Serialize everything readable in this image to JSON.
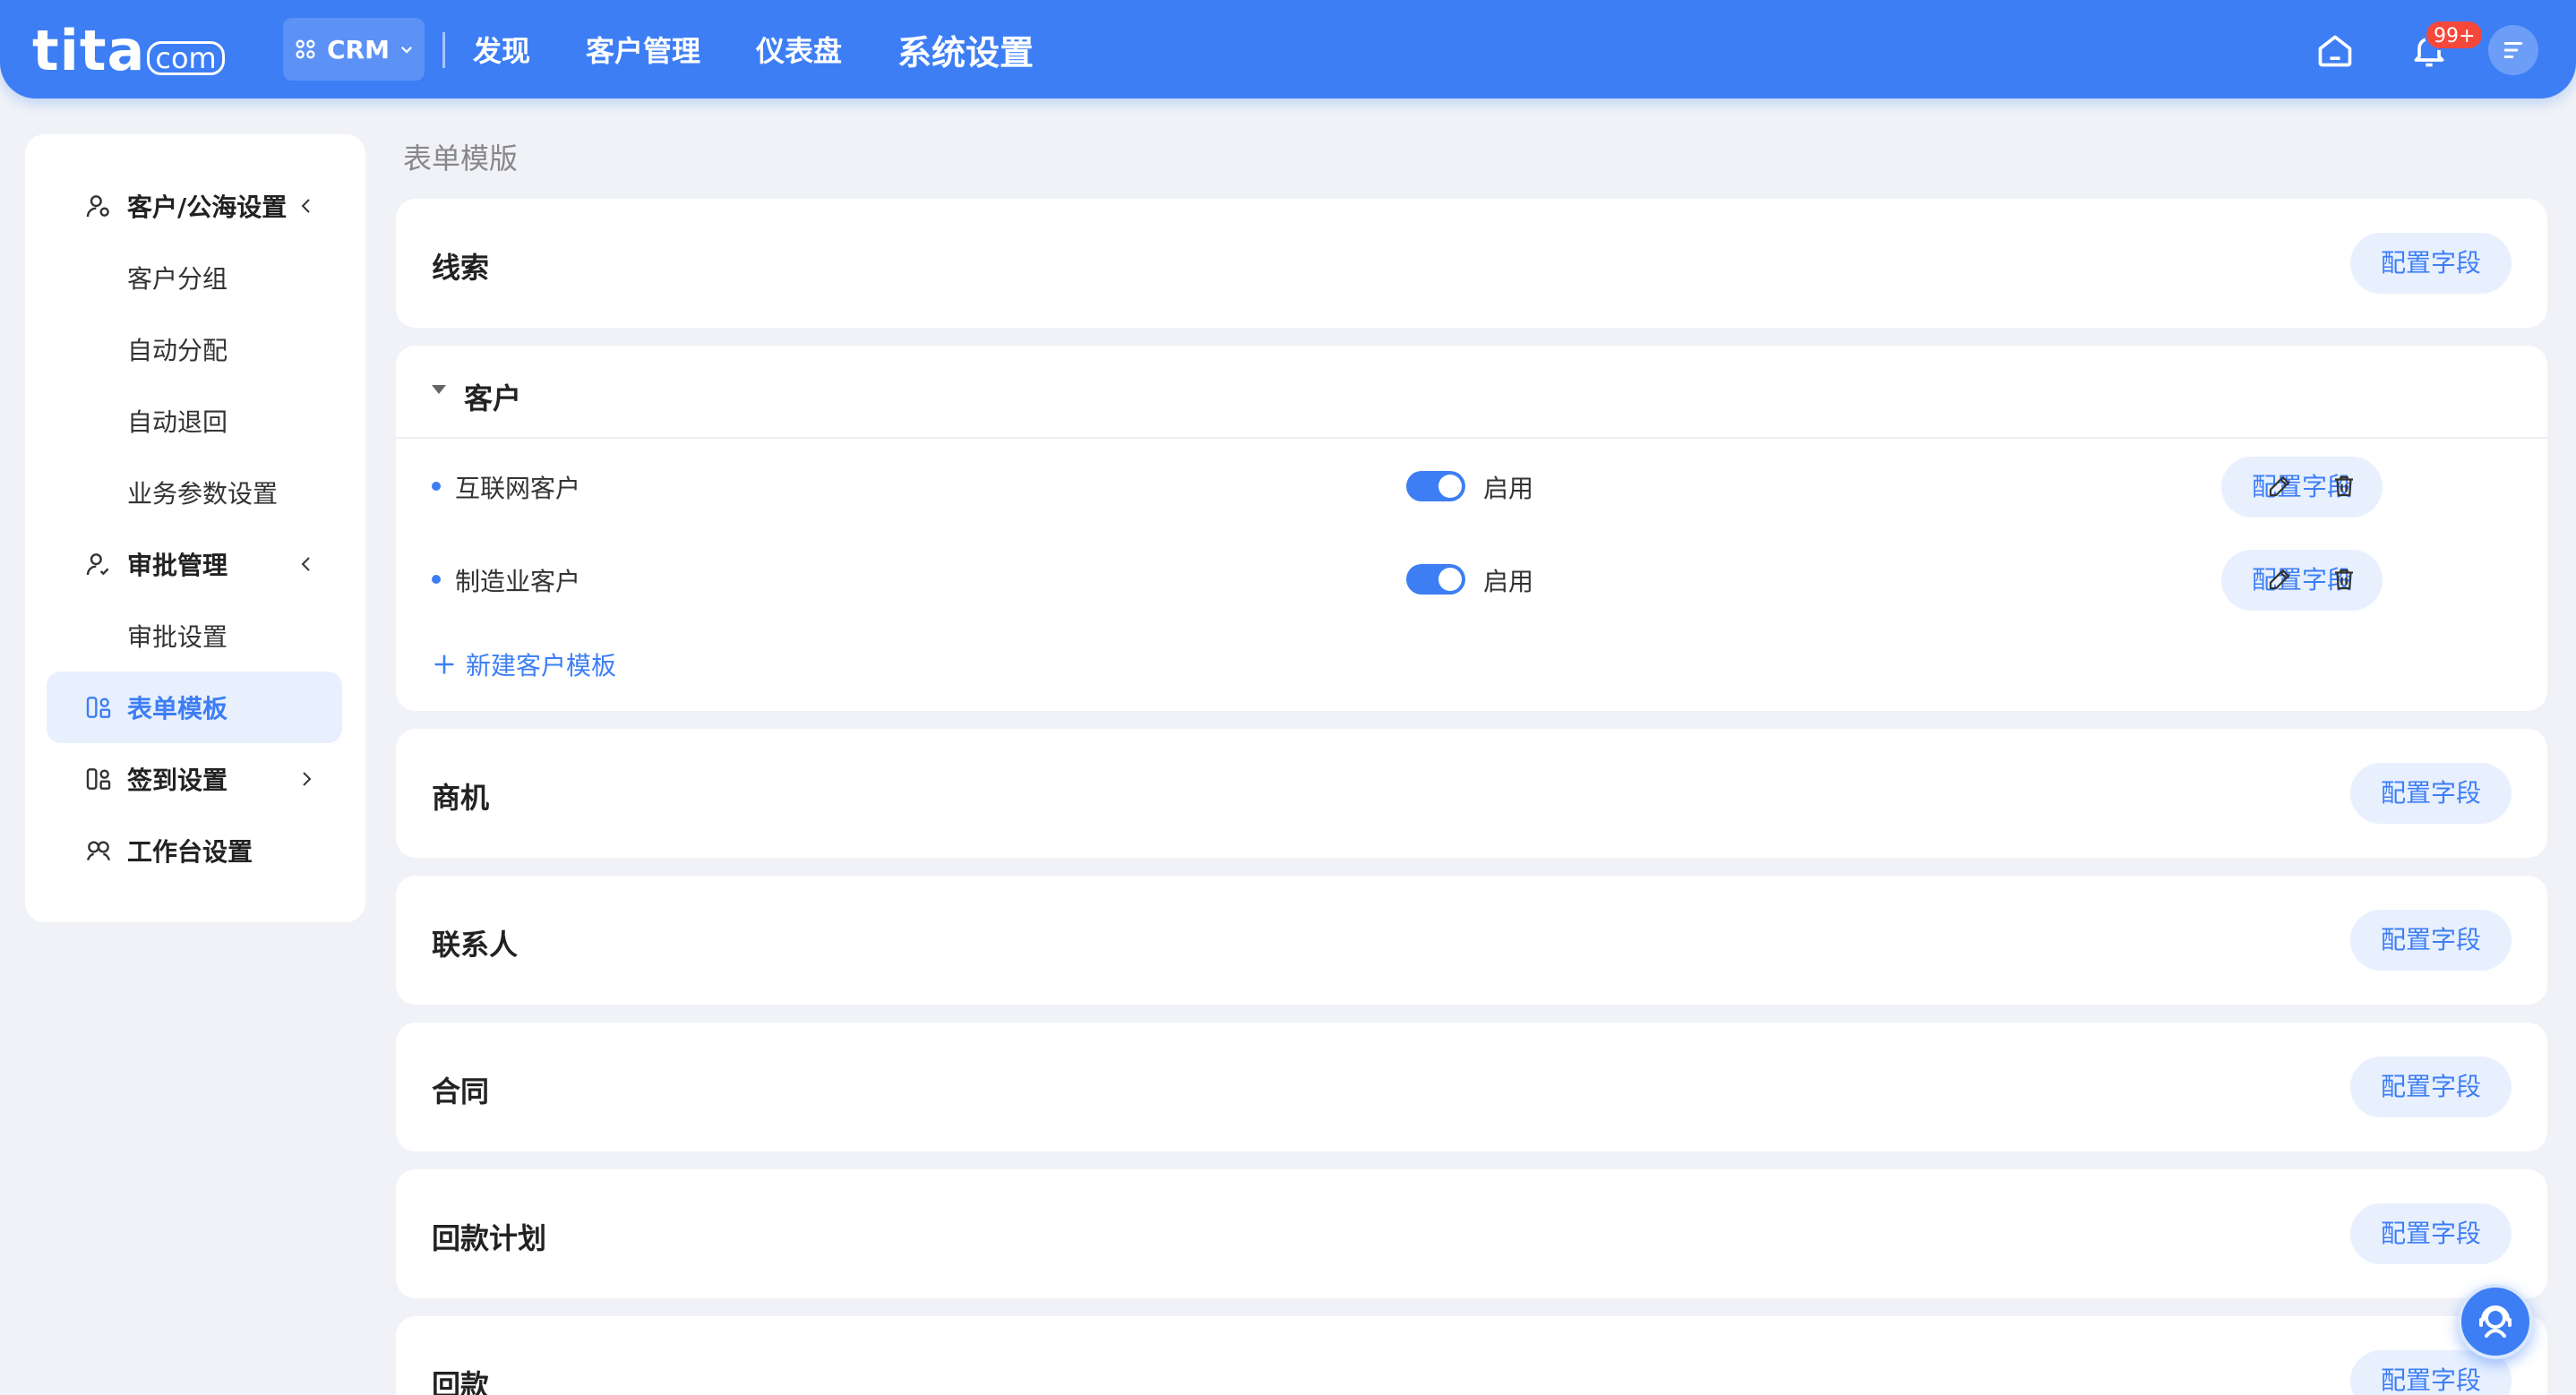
{
  "header": {
    "logo_main": "tita",
    "logo_suffix": "com",
    "app_switch": "CRM",
    "nav": [
      "发现",
      "客户管理",
      "仪表盘",
      "系统设置"
    ],
    "active_nav": "系统设置",
    "notification_badge": "99+",
    "icons": [
      "home-icon",
      "bell-icon",
      "menu-icon"
    ]
  },
  "sidebar": {
    "items": [
      {
        "label": "客户/公海设置",
        "type": "group",
        "icon": "user-gear-icon",
        "arrow": "chevron-left"
      },
      {
        "label": "客户分组",
        "type": "sub"
      },
      {
        "label": "自动分配",
        "type": "sub"
      },
      {
        "label": "自动退回",
        "type": "sub"
      },
      {
        "label": "业务参数设置",
        "type": "sub"
      },
      {
        "label": "审批管理",
        "type": "group",
        "icon": "user-approve-icon",
        "arrow": "chevron-left"
      },
      {
        "label": "审批设置",
        "type": "sub"
      },
      {
        "label": "表单模板",
        "type": "group",
        "icon": "form-icon",
        "active": true
      },
      {
        "label": "签到设置",
        "type": "group",
        "icon": "form-icon",
        "arrow": "chevron-right"
      },
      {
        "label": "工作台设置",
        "type": "group",
        "icon": "workbench-icon"
      }
    ]
  },
  "main": {
    "breadcrumb": "表单模版",
    "config_label": "配置字段",
    "cards": [
      {
        "title": "线索"
      },
      {
        "title": "客户",
        "expanded": true
      },
      {
        "title": "商机"
      },
      {
        "title": "联系人"
      },
      {
        "title": "合同"
      },
      {
        "title": "回款计划"
      },
      {
        "title": "回款"
      }
    ],
    "customer_templates": [
      {
        "name": "互联网客户",
        "status": "启用",
        "enabled": true
      },
      {
        "name": "制造业客户",
        "status": "启用",
        "enabled": true
      }
    ],
    "add_template_label": "新建客户模板"
  },
  "colors": {
    "primary": "#3d7ef5",
    "badge": "#f5483b",
    "light_blue": "#e8f0fe",
    "background": "#f0f2f7"
  }
}
